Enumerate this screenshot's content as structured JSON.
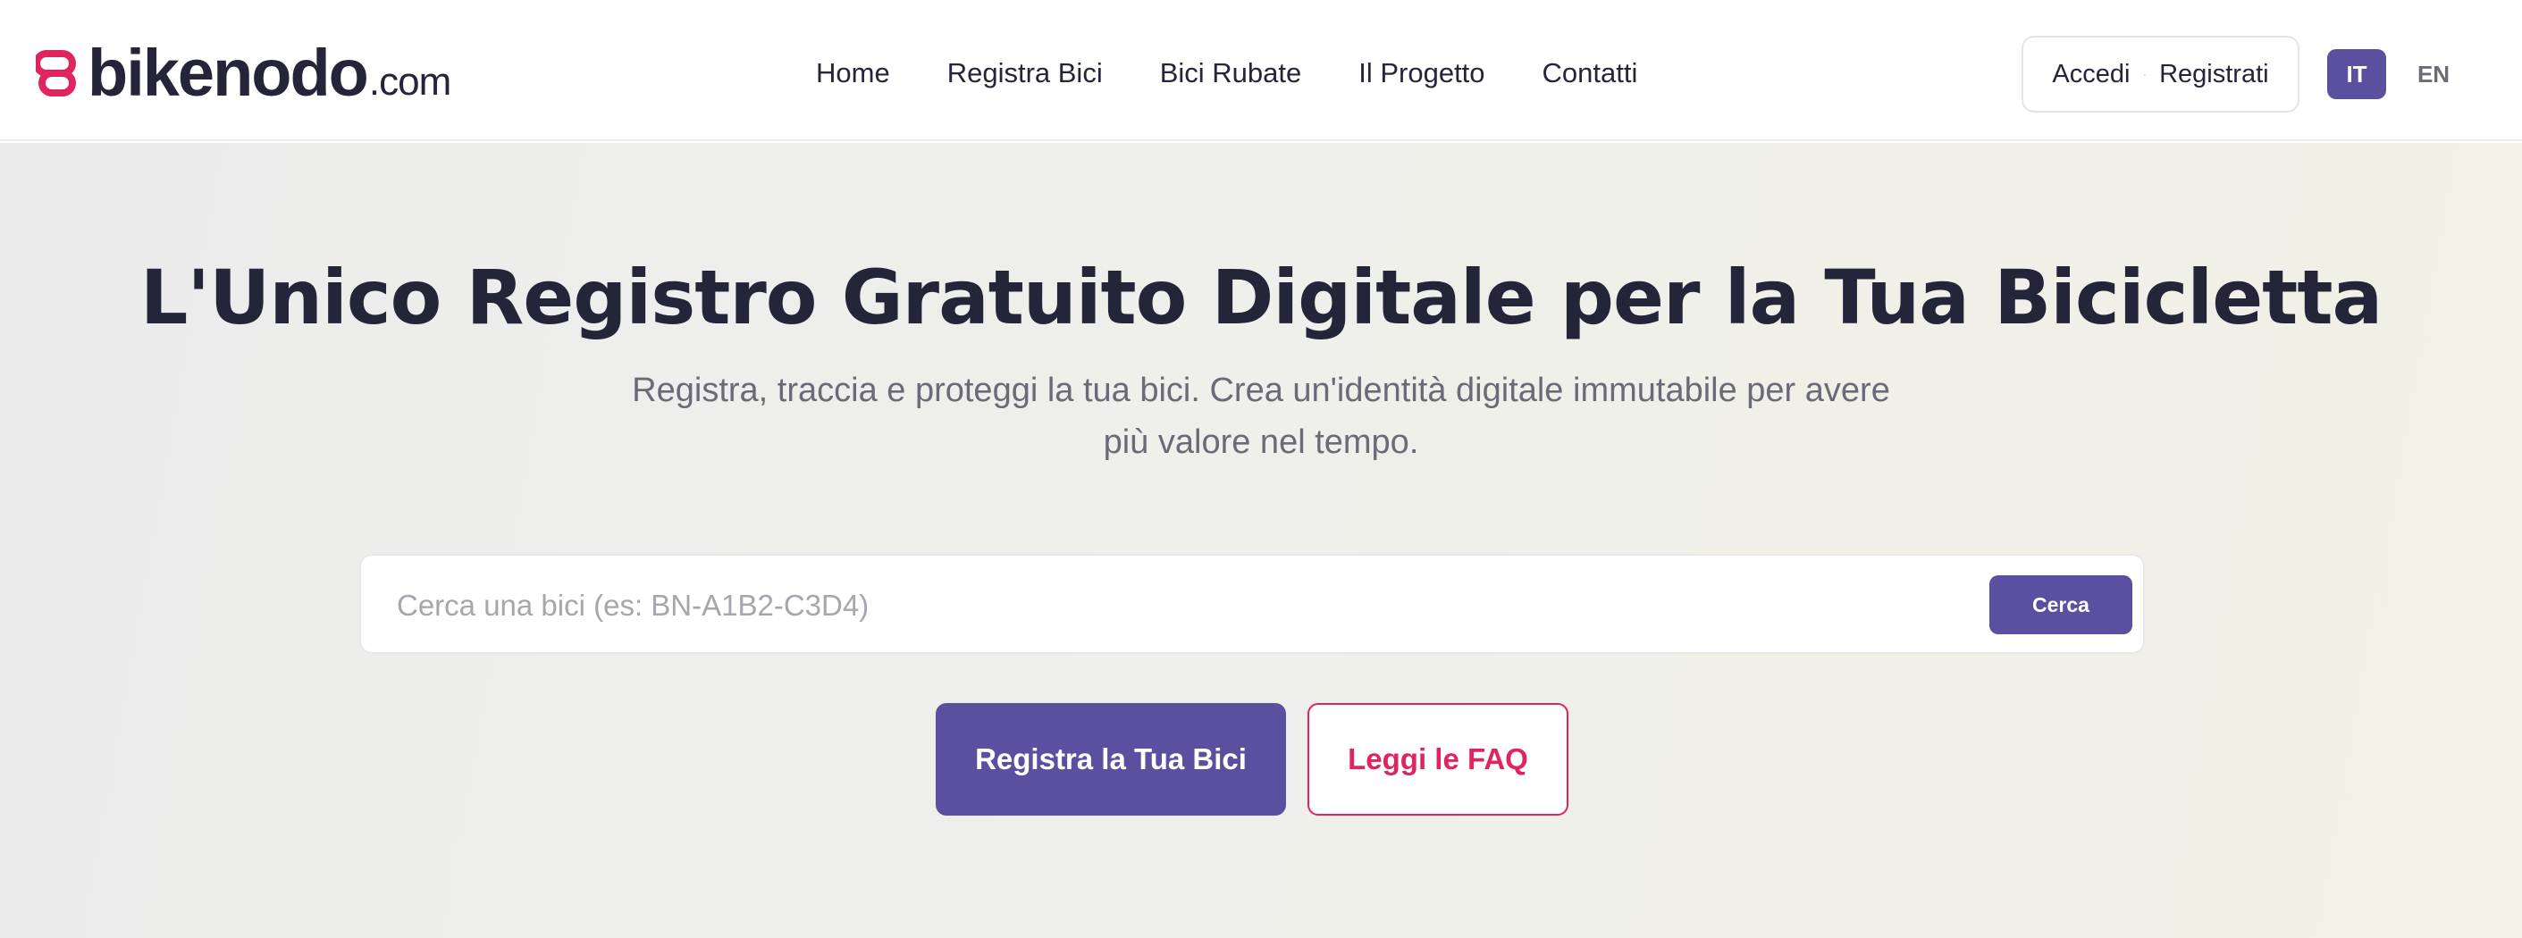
{
  "brand": {
    "name": "bikenodo",
    "suffix": ".com",
    "icon": "bikenodo-link-logo-icon",
    "accent_color": "#e0245e"
  },
  "nav": {
    "items": [
      {
        "label": "Home"
      },
      {
        "label": "Registra Bici"
      },
      {
        "label": "Bici Rubate"
      },
      {
        "label": "Il Progetto"
      },
      {
        "label": "Contatti"
      }
    ]
  },
  "auth": {
    "login_label": "Accedi",
    "separator": "·",
    "register_label": "Registrati"
  },
  "language": {
    "active": "IT",
    "other": "EN",
    "active_color": "#5b50a0"
  },
  "hero": {
    "title": "L'Unico Registro Gratuito Digitale per la Tua Bicicletta",
    "subtitle": "Registra, traccia e proteggi la tua bici. Crea un'identità digitale immutabile per avere più valore nel tempo.",
    "search": {
      "placeholder": "Cerca una bici (es: BN-A1B2-C3D4)",
      "value": "",
      "button_label": "Cerca"
    },
    "primary_cta": "Registra la Tua Bici",
    "secondary_cta": "Leggi le FAQ"
  },
  "colors": {
    "primary": "#5b50a0",
    "accent": "#e0245e",
    "text": "#25253a",
    "muted_text": "#6b6b78"
  }
}
